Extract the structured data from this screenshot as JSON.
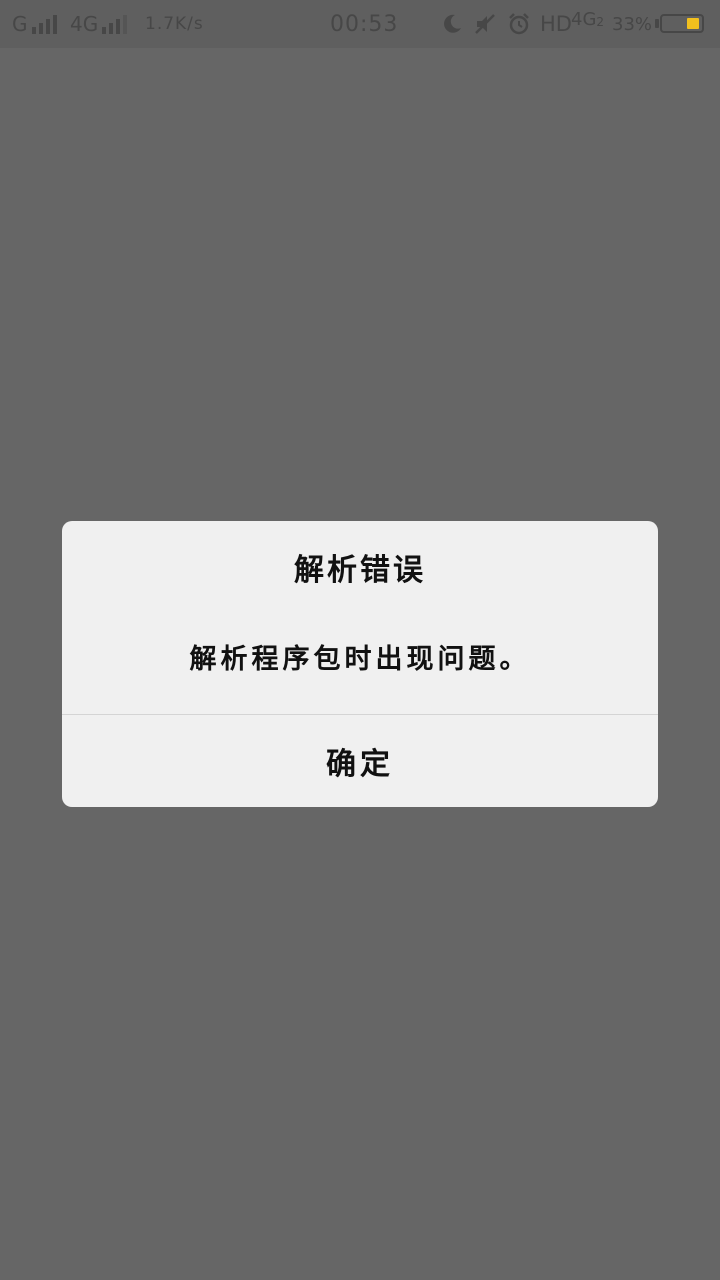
{
  "status_bar": {
    "sim1_network": "G",
    "sim2_network": "4G",
    "net_speed": "1.7K/s",
    "time": "00:53",
    "hd_label": "HD",
    "data_network": "4G",
    "data_sim_index": "2",
    "battery_percent_text": "33%",
    "battery_level": 0.33,
    "battery_color": "#f2c01e",
    "icons": [
      "signal-icon",
      "moon-icon",
      "mute-icon",
      "alarm-icon",
      "battery-icon"
    ]
  },
  "dialog": {
    "title": "解析错误",
    "message": "解析程序包时出现问题。",
    "confirm_label": "确定"
  }
}
